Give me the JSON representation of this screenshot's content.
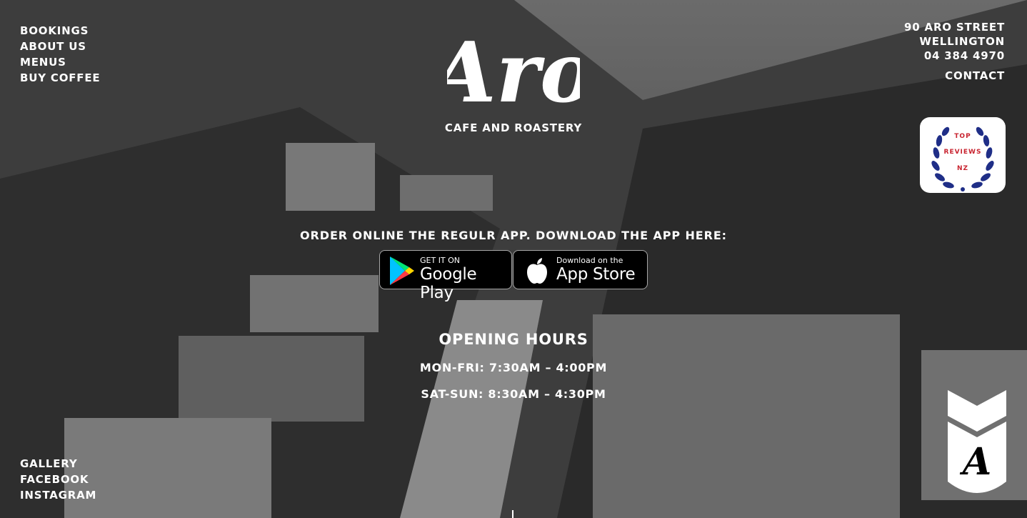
{
  "nav": {
    "top_left": [
      "BOOKINGS",
      "ABOUT US",
      "MENUS",
      "BUY COFFEE"
    ],
    "bottom_left": [
      "GALLERY",
      "FACEBOOK",
      "INSTAGRAM"
    ]
  },
  "brand": {
    "logo_text": "Aro",
    "tagline": "CAFE AND ROASTERY"
  },
  "address": {
    "street": "90 ARO STREET",
    "city": "WELLINGTON",
    "phone": "04 384 4970",
    "contact": "CONTACT"
  },
  "badge": {
    "line1": "TOP",
    "line2": "REVIEWS",
    "line3": "NZ"
  },
  "order": {
    "text": "ORDER ONLINE THE REGULR APP. DOWNLOAD THE APP HERE:",
    "google": {
      "small": "GET IT ON",
      "big": "Google Play"
    },
    "apple": {
      "small": "Download on the",
      "big": "App Store"
    }
  },
  "hours": {
    "title": "OPENING HOURS",
    "weekday": "MON-FRI: 7:30AM – 4:00PM",
    "weekend": "SAT-SUN: 8:30AM – 4:30PM"
  },
  "colors": {
    "badge_red": "#c8232f",
    "laurel_blue": "#1f2e87",
    "text": "#ffffff"
  }
}
